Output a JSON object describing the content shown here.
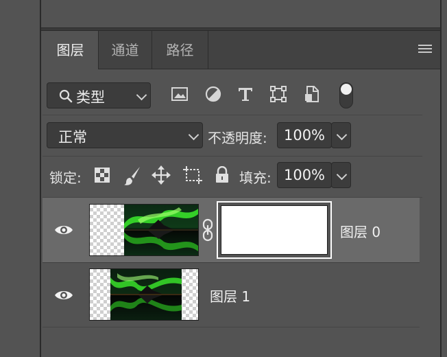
{
  "tabs": [
    {
      "label": "图层",
      "active": true
    },
    {
      "label": "通道",
      "active": false
    },
    {
      "label": "路径",
      "active": false
    }
  ],
  "filter": {
    "kind_label": "类型",
    "icons": [
      "image-filter-icon",
      "adjustment-filter-icon",
      "type-filter-icon",
      "shape-filter-icon",
      "smart-object-filter-icon"
    ]
  },
  "blend": {
    "mode": "正常",
    "opacity_label": "不透明度:",
    "opacity_value": "100%"
  },
  "lock": {
    "label": "锁定:",
    "fill_label": "填充:",
    "fill_value": "100%"
  },
  "layers": [
    {
      "name": "图层 0",
      "visible": true,
      "selected": true,
      "has_mask": true
    },
    {
      "name": "图层 1",
      "visible": true,
      "selected": false,
      "has_mask": false
    }
  ],
  "colors": {
    "panel_bg": "#535353",
    "tab_bar_bg": "#424242",
    "selected_row_bg": "#6a6a6a",
    "aurora_green": "#39e02a"
  }
}
